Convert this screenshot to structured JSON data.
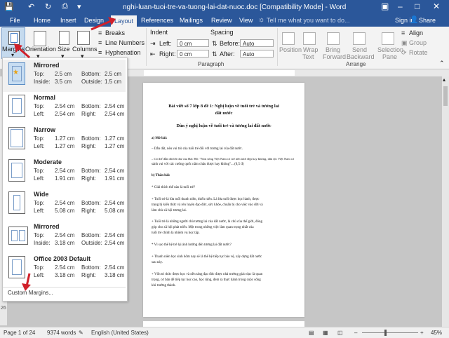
{
  "window": {
    "title": "nghi-luan-tuoi-tre-va-tuong-lai-dat-nuoc.doc [Compatibility Mode] - Word"
  },
  "tabs": [
    "File",
    "Home",
    "Insert",
    "Design",
    "Layout",
    "References",
    "Mailings",
    "Review",
    "View"
  ],
  "tell_me": "Tell me what you want to do...",
  "account": {
    "sign_in": "Sign in",
    "share": "Share"
  },
  "ribbon": {
    "margins": "Margins",
    "orientation": "Orientation",
    "size": "Size",
    "columns": "Columns",
    "breaks": "Breaks",
    "line_numbers": "Line Numbers",
    "hyphenation": "Hyphenation",
    "indent_title": "Indent",
    "indent_left_label": "Left:",
    "indent_left_value": "0 cm",
    "indent_right_label": "Right:",
    "indent_right_value": "0 cm",
    "spacing_title": "Spacing",
    "spacing_before_label": "Before:",
    "spacing_before_value": "Auto",
    "spacing_after_label": "After:",
    "spacing_after_value": "Auto",
    "paragraph_group": "Paragraph",
    "arrange_group": "Arrange",
    "position": "Position",
    "wrap_text_1": "Wrap",
    "wrap_text_2": "Text",
    "bring_forward_1": "Bring",
    "bring_forward_2": "Forward",
    "send_backward_1": "Send",
    "send_backward_2": "Backward",
    "selection_pane_1": "Selection",
    "selection_pane_2": "Pane",
    "align": "Align",
    "group": "Group",
    "rotate": "Rotate"
  },
  "margins_menu": {
    "options": [
      {
        "name": "Mirrored",
        "l1a": "Top:",
        "v1a": "2.5 cm",
        "l1b": "Bottom:",
        "v1b": "2.5 cm",
        "l2a": "Inside:",
        "v2a": "3.5 cm",
        "l2b": "Outside:",
        "v2b": "1.5 cm"
      },
      {
        "name": "Normal",
        "l1a": "Top:",
        "v1a": "2.54 cm",
        "l1b": "Bottom:",
        "v1b": "2.54 cm",
        "l2a": "Left:",
        "v2a": "2.54 cm",
        "l2b": "Right:",
        "v2b": "2.54 cm"
      },
      {
        "name": "Narrow",
        "l1a": "Top:",
        "v1a": "1.27 cm",
        "l1b": "Bottom:",
        "v1b": "1.27 cm",
        "l2a": "Left:",
        "v2a": "1.27 cm",
        "l2b": "Right:",
        "v2b": "1.27 cm"
      },
      {
        "name": "Moderate",
        "l1a": "Top:",
        "v1a": "2.54 cm",
        "l1b": "Bottom:",
        "v1b": "2.54 cm",
        "l2a": "Left:",
        "v2a": "1.91 cm",
        "l2b": "Right:",
        "v2b": "1.91 cm"
      },
      {
        "name": "Wide",
        "l1a": "Top:",
        "v1a": "2.54 cm",
        "l1b": "Bottom:",
        "v1b": "2.54 cm",
        "l2a": "Left:",
        "v2a": "5.08 cm",
        "l2b": "Right:",
        "v2b": "5.08 cm"
      },
      {
        "name": "Mirrored",
        "l1a": "Top:",
        "v1a": "2.54 cm",
        "l1b": "Bottom:",
        "v1b": "2.54 cm",
        "l2a": "Inside:",
        "v2a": "3.18 cm",
        "l2b": "Outside:",
        "v2b": "2.54 cm"
      },
      {
        "name": "Office 2003 Default",
        "l1a": "Top:",
        "v1a": "2.54 cm",
        "l1b": "Bottom:",
        "v1b": "2.54 cm",
        "l2a": "Left:",
        "v2a": "3.18 cm",
        "l2b": "Right:",
        "v2b": "3.18 cm"
      }
    ],
    "custom": "Custom Margins..."
  },
  "document": {
    "title1": "Bài viết số 7 lớp 8 đề 1: Nghị luận về tuổi trẻ và tương lai",
    "title2": "đất nước",
    "subtitle": "Dàn ý nghị luận về tuổi trẻ và tương lai đất nước",
    "lines": [
      "a) Mở bài:",
      "– Dẫn dắt, nêu vai trò của tuổi trẻ đối với tương lai của đất nước.",
      "– Có thể dẫn dắt lời thư của Bác Hồ: \"Non sông Việt Nam có trở nên tươi đẹp hay không, dân tộc Việt Nam có",
      "sánh vai với các cường quốc năm châu được hay không\"... (0,5 đ)",
      "b) Thân bài:",
      "* Giải thích thế nào là tuổi trẻ?",
      "+ Tuổi trẻ là lứa tuổi thanh niên, thiếu niên. Là lứa tuổi được học hành, được",
      "trang bị kiến thức và rèn luyện đạo đức, sức khỏe, chuẩn bị cho việc vào đời và",
      "làm chủ xã hội tương lai.",
      "+ Tuổi trẻ là những người chủ tương lai của đất nước, là chủ của thế giới, đóng",
      "góp cho xã hội phát triển. Một trong những việc làm quan trọng nhất của",
      "tuổi trẻ chính là nhiệm vụ học tập.",
      "* Vì sao thế hệ trẻ lại ảnh hưởng đến tương lai đất nước?",
      "+ Thanh niên học sinh hôm nay sẽ là thế hệ tiếp tục bảo vệ, xây dựng đất nước",
      "sau này.",
      "+ Vốn tri thức được học và nền tảng đạo đức được nhà trường giáo dục là quan",
      "trọng, cơ bản để tiếp tục học cao, học rộng, đem ra thực hành trong cuộc sống",
      "khi trưởng thành."
    ]
  },
  "status": {
    "page": "Page 1 of 24",
    "words": "9374 words",
    "language": "English (United States)",
    "zoom": "45%"
  },
  "colors": {
    "word_blue": "#2b579a",
    "arrow_red": "#d0202a"
  }
}
